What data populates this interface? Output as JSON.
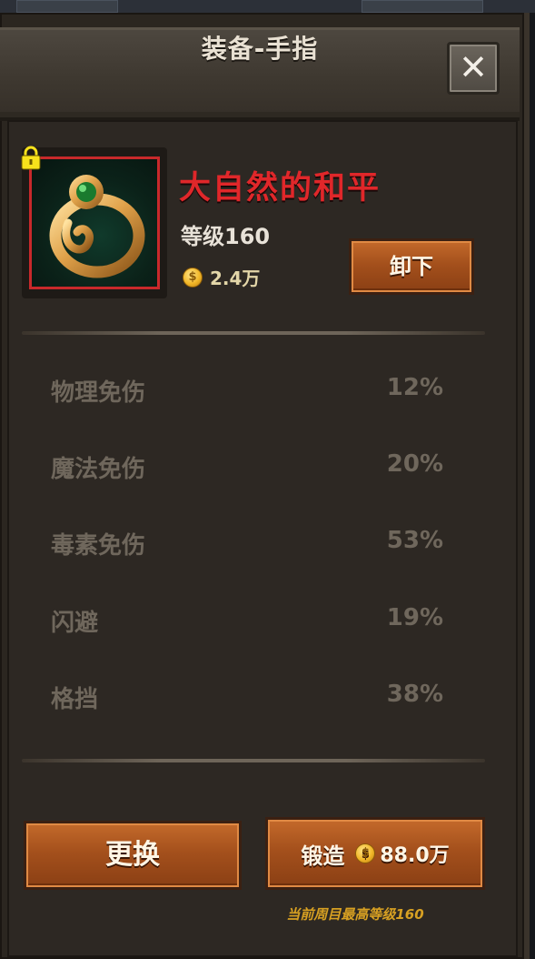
{
  "header": {
    "title": "装备-手指",
    "close_label": "✕"
  },
  "item": {
    "name": "大自然的和平",
    "level": "等级160",
    "price": "2.4万",
    "unequip_label": "卸下",
    "name_color": "#e0272a",
    "icon": "ring-icon",
    "locked": true
  },
  "stats": [
    {
      "name": "物理免伤",
      "value": "12%"
    },
    {
      "name": "魔法免伤",
      "value": "20%"
    },
    {
      "name": "毒素免伤",
      "value": "53%"
    },
    {
      "name": "闪避",
      "value": "19%"
    },
    {
      "name": "格挡",
      "value": "38%"
    }
  ],
  "actions": {
    "replace_label": "更换",
    "forge_label": "锻造",
    "forge_cost": "88.0万",
    "forge_note": "当前周目最高等级160"
  },
  "colors": {
    "button_orange": "#a4501c",
    "note_gold": "#d7a022",
    "stat_text": "#6f675c"
  }
}
